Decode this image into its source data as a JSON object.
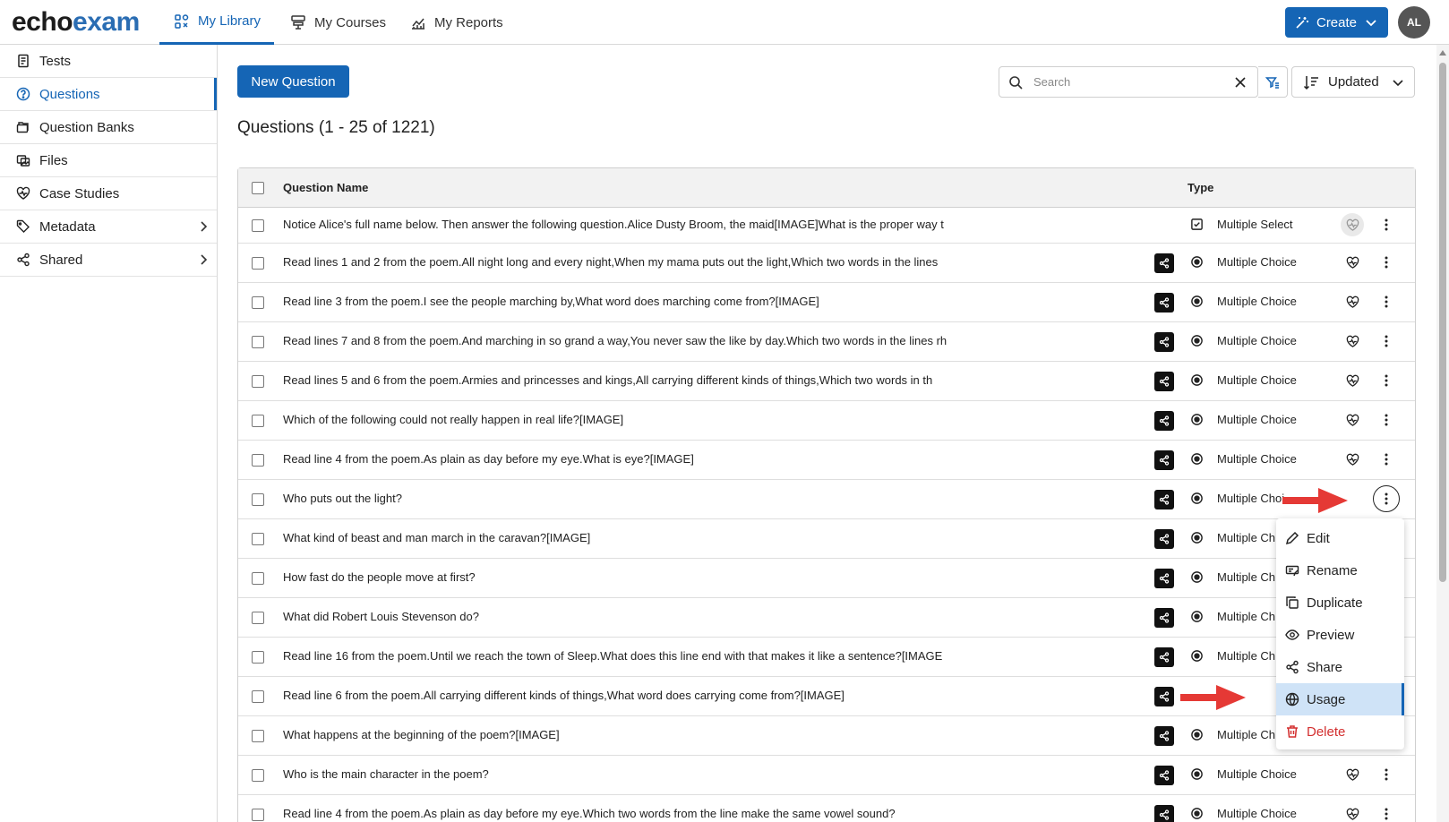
{
  "brand": {
    "part1": "echo",
    "part2": "exam"
  },
  "nav": {
    "tabs": [
      {
        "label": "My Library",
        "icon": "library-icon",
        "active": true
      },
      {
        "label": "My Courses",
        "icon": "courses-icon",
        "active": false
      },
      {
        "label": "My Reports",
        "icon": "reports-icon",
        "active": false
      }
    ],
    "create_label": "Create",
    "avatar_initials": "AL"
  },
  "sidebar": {
    "items": [
      {
        "label": "Tests",
        "icon": "document-icon"
      },
      {
        "label": "Questions",
        "icon": "question-icon",
        "active": true
      },
      {
        "label": "Question Banks",
        "icon": "folders-icon"
      },
      {
        "label": "Files",
        "icon": "images-icon"
      },
      {
        "label": "Case Studies",
        "icon": "heart-pulse-icon"
      },
      {
        "label": "Metadata",
        "icon": "tag-icon",
        "has_submenu": true
      },
      {
        "label": "Shared",
        "icon": "share-icon",
        "has_submenu": true
      }
    ]
  },
  "toolbar": {
    "new_question_label": "New Question",
    "search_placeholder": "Search",
    "sort_label": "Updated"
  },
  "list": {
    "heading": "Questions (1 - 25 of 1221)",
    "columns": {
      "name": "Question Name",
      "type": "Type"
    },
    "rows": [
      {
        "name": "Notice Alice's full name below. Then answer the following question.Alice Dusty Broom, the maid[IMAGE]What is the proper way t",
        "type": "Multiple Select"
      },
      {
        "name": "Read lines 1 and 2 from the poem.All night long and every night,When my mama puts out the light,Which two words in the lines",
        "type": "Multiple Choice"
      },
      {
        "name": "Read line 3 from the poem.I see the people marching by,What word does marching come from?[IMAGE]",
        "type": "Multiple Choice"
      },
      {
        "name": "Read lines 7 and 8 from the poem.And marching in so grand a way,You never saw the like by day.Which two words in the lines rh",
        "type": "Multiple Choice"
      },
      {
        "name": "Read lines 5 and 6 from the poem.Armies and princesses and kings,All carrying different kinds of things,Which two words in th",
        "type": "Multiple Choice"
      },
      {
        "name": "Which of the following could not really happen in real life?[IMAGE]",
        "type": "Multiple Choice"
      },
      {
        "name": "Read line 4 from the poem.As plain as day before my eye.What is eye?[IMAGE]",
        "type": "Multiple Choice"
      },
      {
        "name": "Who puts out the light?",
        "type": "Multiple Choi"
      },
      {
        "name": "What kind of beast and man march in the caravan?[IMAGE]",
        "type": "Multiple Ch"
      },
      {
        "name": "How fast do the people move at first?",
        "type": "Multiple Ch"
      },
      {
        "name": "What did Robert Louis Stevenson do?",
        "type": "Multiple Ch"
      },
      {
        "name": "Read line 16 from the poem.Until we reach the town of Sleep.What does this line end with that makes it like a sentence?[IMAGE",
        "type": "Multiple Ch"
      },
      {
        "name": "Read line 6 from the poem.All carrying different kinds of things,What word does carrying come from?[IMAGE]",
        "type": ""
      },
      {
        "name": "What happens at the beginning of the poem?[IMAGE]",
        "type": "Multiple Ch"
      },
      {
        "name": "Who is the main character in the poem?",
        "type": "Multiple Choice"
      },
      {
        "name": "Read line 4 from the poem.As plain as day before my eye.Which two words from the line make the same vowel sound?",
        "type": "Multiple Choice"
      }
    ]
  },
  "context_menu": {
    "items": [
      {
        "label": "Edit",
        "icon": "pencil-icon"
      },
      {
        "label": "Rename",
        "icon": "rename-icon"
      },
      {
        "label": "Duplicate",
        "icon": "copy-icon"
      },
      {
        "label": "Preview",
        "icon": "eye-icon"
      },
      {
        "label": "Share",
        "icon": "share-icon"
      },
      {
        "label": "Usage",
        "icon": "globe-icon",
        "selected": true
      },
      {
        "label": "Delete",
        "icon": "trash-icon",
        "danger": true
      }
    ]
  },
  "colors": {
    "primary": "#1565b5",
    "annotation_arrow": "#e53935",
    "danger": "#d32f2f"
  }
}
